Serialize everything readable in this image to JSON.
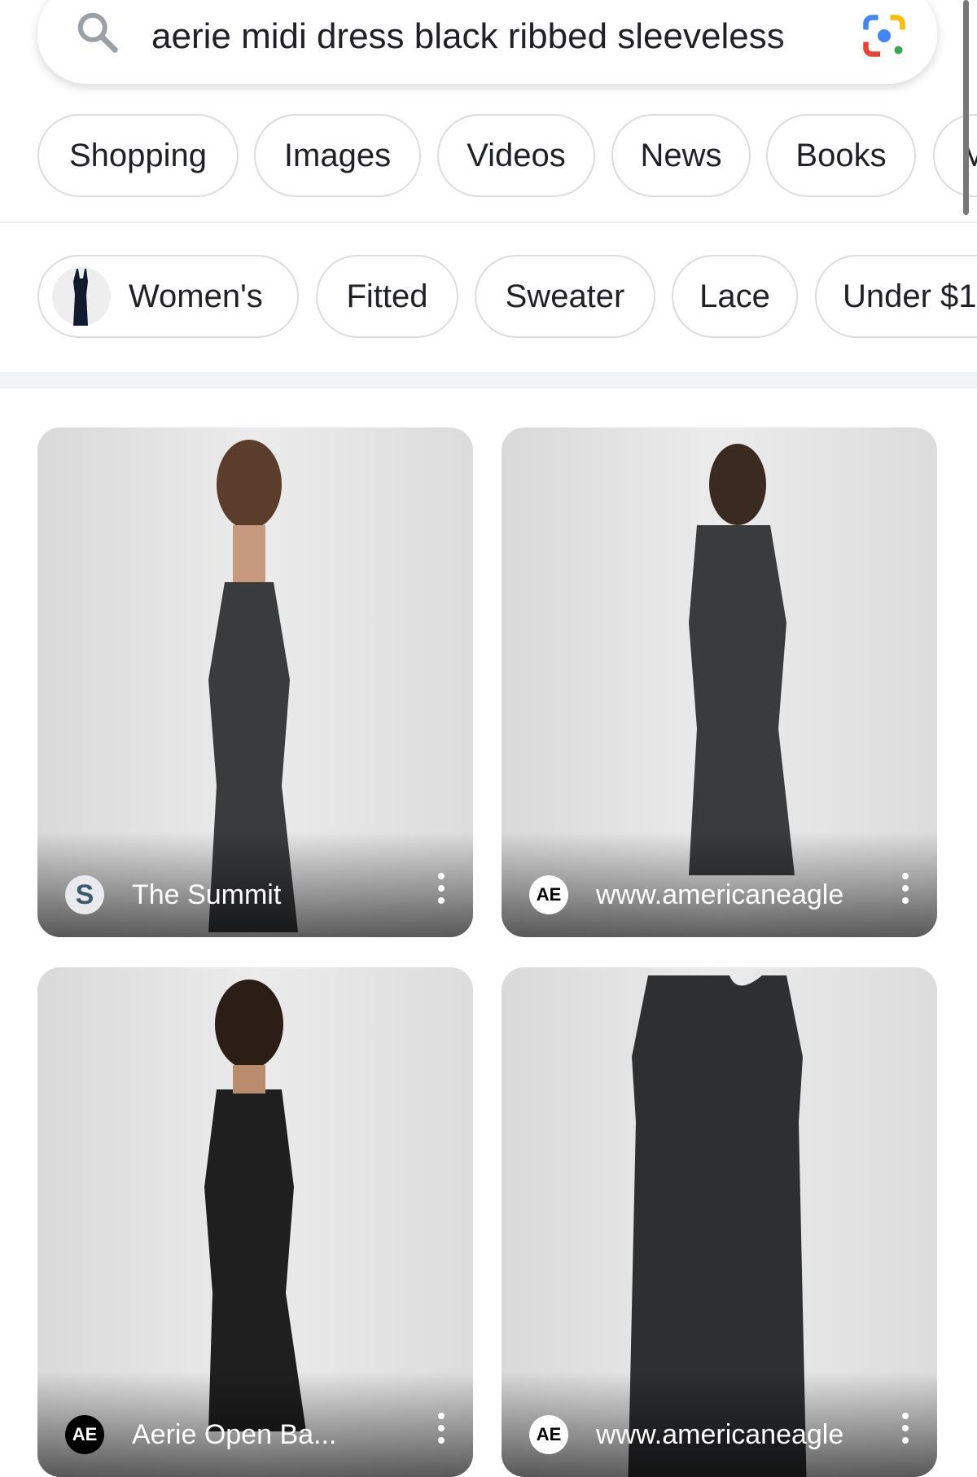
{
  "search": {
    "query": "aerie midi dress black ribbed sleeveless",
    "icon": "search-icon",
    "lens_icon": "google-lens-icon"
  },
  "tabs": [
    {
      "label": "Shopping"
    },
    {
      "label": "Images"
    },
    {
      "label": "Videos"
    },
    {
      "label": "News"
    },
    {
      "label": "Books"
    },
    {
      "label": "M"
    }
  ],
  "filters": [
    {
      "label": "Women's",
      "thumbnail": "dress-thumbnail"
    },
    {
      "label": "Fitted"
    },
    {
      "label": "Sweater"
    },
    {
      "label": "Lace"
    },
    {
      "label": "Under $1"
    }
  ],
  "results": [
    {
      "source": "The Summit",
      "logo_text": "S",
      "logo_bg": "#e8eaed",
      "logo_color": "#3c5a6e"
    },
    {
      "source": "www.americaneagle",
      "logo_text": "AE",
      "logo_bg": "#ffffff",
      "logo_color": "#000000"
    },
    {
      "source": "Aerie Open Ba...",
      "logo_text": "AE",
      "logo_bg": "#000000",
      "logo_color": "#ffffff"
    },
    {
      "source": "www.americaneagle",
      "logo_text": "AE",
      "logo_bg": "#ffffff",
      "logo_color": "#000000"
    }
  ]
}
